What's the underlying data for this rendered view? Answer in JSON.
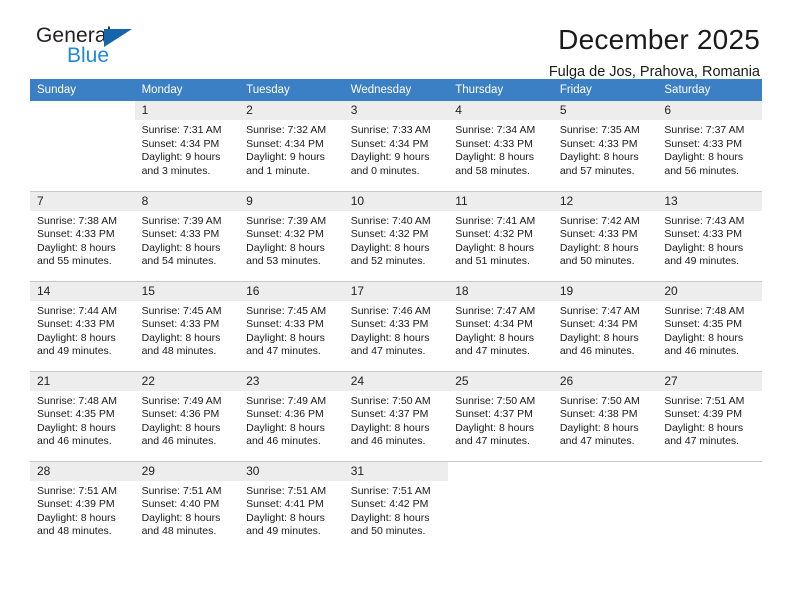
{
  "logo": {
    "word1": "General",
    "word2": "Blue",
    "triangle_color": "#1565ab",
    "word2_color": "#2389d4"
  },
  "header": {
    "title": "December 2025",
    "subtitle": "Fulga de Jos, Prahova, Romania"
  },
  "theme": {
    "header_row_bg": "#3b7fc4",
    "header_row_text": "#ffffff",
    "daynum_bg": "#ededed",
    "grid_line": "#c8c8c8"
  },
  "weekdays": [
    "Sunday",
    "Monday",
    "Tuesday",
    "Wednesday",
    "Thursday",
    "Friday",
    "Saturday"
  ],
  "weeks": [
    [
      {
        "day": "",
        "sunrise": "",
        "sunset": "",
        "daylight1": "",
        "daylight2": ""
      },
      {
        "day": "1",
        "sunrise": "Sunrise: 7:31 AM",
        "sunset": "Sunset: 4:34 PM",
        "daylight1": "Daylight: 9 hours",
        "daylight2": "and 3 minutes."
      },
      {
        "day": "2",
        "sunrise": "Sunrise: 7:32 AM",
        "sunset": "Sunset: 4:34 PM",
        "daylight1": "Daylight: 9 hours",
        "daylight2": "and 1 minute."
      },
      {
        "day": "3",
        "sunrise": "Sunrise: 7:33 AM",
        "sunset": "Sunset: 4:34 PM",
        "daylight1": "Daylight: 9 hours",
        "daylight2": "and 0 minutes."
      },
      {
        "day": "4",
        "sunrise": "Sunrise: 7:34 AM",
        "sunset": "Sunset: 4:33 PM",
        "daylight1": "Daylight: 8 hours",
        "daylight2": "and 58 minutes."
      },
      {
        "day": "5",
        "sunrise": "Sunrise: 7:35 AM",
        "sunset": "Sunset: 4:33 PM",
        "daylight1": "Daylight: 8 hours",
        "daylight2": "and 57 minutes."
      },
      {
        "day": "6",
        "sunrise": "Sunrise: 7:37 AM",
        "sunset": "Sunset: 4:33 PM",
        "daylight1": "Daylight: 8 hours",
        "daylight2": "and 56 minutes."
      }
    ],
    [
      {
        "day": "7",
        "sunrise": "Sunrise: 7:38 AM",
        "sunset": "Sunset: 4:33 PM",
        "daylight1": "Daylight: 8 hours",
        "daylight2": "and 55 minutes."
      },
      {
        "day": "8",
        "sunrise": "Sunrise: 7:39 AM",
        "sunset": "Sunset: 4:33 PM",
        "daylight1": "Daylight: 8 hours",
        "daylight2": "and 54 minutes."
      },
      {
        "day": "9",
        "sunrise": "Sunrise: 7:39 AM",
        "sunset": "Sunset: 4:32 PM",
        "daylight1": "Daylight: 8 hours",
        "daylight2": "and 53 minutes."
      },
      {
        "day": "10",
        "sunrise": "Sunrise: 7:40 AM",
        "sunset": "Sunset: 4:32 PM",
        "daylight1": "Daylight: 8 hours",
        "daylight2": "and 52 minutes."
      },
      {
        "day": "11",
        "sunrise": "Sunrise: 7:41 AM",
        "sunset": "Sunset: 4:32 PM",
        "daylight1": "Daylight: 8 hours",
        "daylight2": "and 51 minutes."
      },
      {
        "day": "12",
        "sunrise": "Sunrise: 7:42 AM",
        "sunset": "Sunset: 4:33 PM",
        "daylight1": "Daylight: 8 hours",
        "daylight2": "and 50 minutes."
      },
      {
        "day": "13",
        "sunrise": "Sunrise: 7:43 AM",
        "sunset": "Sunset: 4:33 PM",
        "daylight1": "Daylight: 8 hours",
        "daylight2": "and 49 minutes."
      }
    ],
    [
      {
        "day": "14",
        "sunrise": "Sunrise: 7:44 AM",
        "sunset": "Sunset: 4:33 PM",
        "daylight1": "Daylight: 8 hours",
        "daylight2": "and 49 minutes."
      },
      {
        "day": "15",
        "sunrise": "Sunrise: 7:45 AM",
        "sunset": "Sunset: 4:33 PM",
        "daylight1": "Daylight: 8 hours",
        "daylight2": "and 48 minutes."
      },
      {
        "day": "16",
        "sunrise": "Sunrise: 7:45 AM",
        "sunset": "Sunset: 4:33 PM",
        "daylight1": "Daylight: 8 hours",
        "daylight2": "and 47 minutes."
      },
      {
        "day": "17",
        "sunrise": "Sunrise: 7:46 AM",
        "sunset": "Sunset: 4:33 PM",
        "daylight1": "Daylight: 8 hours",
        "daylight2": "and 47 minutes."
      },
      {
        "day": "18",
        "sunrise": "Sunrise: 7:47 AM",
        "sunset": "Sunset: 4:34 PM",
        "daylight1": "Daylight: 8 hours",
        "daylight2": "and 47 minutes."
      },
      {
        "day": "19",
        "sunrise": "Sunrise: 7:47 AM",
        "sunset": "Sunset: 4:34 PM",
        "daylight1": "Daylight: 8 hours",
        "daylight2": "and 46 minutes."
      },
      {
        "day": "20",
        "sunrise": "Sunrise: 7:48 AM",
        "sunset": "Sunset: 4:35 PM",
        "daylight1": "Daylight: 8 hours",
        "daylight2": "and 46 minutes."
      }
    ],
    [
      {
        "day": "21",
        "sunrise": "Sunrise: 7:48 AM",
        "sunset": "Sunset: 4:35 PM",
        "daylight1": "Daylight: 8 hours",
        "daylight2": "and 46 minutes."
      },
      {
        "day": "22",
        "sunrise": "Sunrise: 7:49 AM",
        "sunset": "Sunset: 4:36 PM",
        "daylight1": "Daylight: 8 hours",
        "daylight2": "and 46 minutes."
      },
      {
        "day": "23",
        "sunrise": "Sunrise: 7:49 AM",
        "sunset": "Sunset: 4:36 PM",
        "daylight1": "Daylight: 8 hours",
        "daylight2": "and 46 minutes."
      },
      {
        "day": "24",
        "sunrise": "Sunrise: 7:50 AM",
        "sunset": "Sunset: 4:37 PM",
        "daylight1": "Daylight: 8 hours",
        "daylight2": "and 46 minutes."
      },
      {
        "day": "25",
        "sunrise": "Sunrise: 7:50 AM",
        "sunset": "Sunset: 4:37 PM",
        "daylight1": "Daylight: 8 hours",
        "daylight2": "and 47 minutes."
      },
      {
        "day": "26",
        "sunrise": "Sunrise: 7:50 AM",
        "sunset": "Sunset: 4:38 PM",
        "daylight1": "Daylight: 8 hours",
        "daylight2": "and 47 minutes."
      },
      {
        "day": "27",
        "sunrise": "Sunrise: 7:51 AM",
        "sunset": "Sunset: 4:39 PM",
        "daylight1": "Daylight: 8 hours",
        "daylight2": "and 47 minutes."
      }
    ],
    [
      {
        "day": "28",
        "sunrise": "Sunrise: 7:51 AM",
        "sunset": "Sunset: 4:39 PM",
        "daylight1": "Daylight: 8 hours",
        "daylight2": "and 48 minutes."
      },
      {
        "day": "29",
        "sunrise": "Sunrise: 7:51 AM",
        "sunset": "Sunset: 4:40 PM",
        "daylight1": "Daylight: 8 hours",
        "daylight2": "and 48 minutes."
      },
      {
        "day": "30",
        "sunrise": "Sunrise: 7:51 AM",
        "sunset": "Sunset: 4:41 PM",
        "daylight1": "Daylight: 8 hours",
        "daylight2": "and 49 minutes."
      },
      {
        "day": "31",
        "sunrise": "Sunrise: 7:51 AM",
        "sunset": "Sunset: 4:42 PM",
        "daylight1": "Daylight: 8 hours",
        "daylight2": "and 50 minutes."
      },
      {
        "day": "",
        "sunrise": "",
        "sunset": "",
        "daylight1": "",
        "daylight2": ""
      },
      {
        "day": "",
        "sunrise": "",
        "sunset": "",
        "daylight1": "",
        "daylight2": ""
      },
      {
        "day": "",
        "sunrise": "",
        "sunset": "",
        "daylight1": "",
        "daylight2": ""
      }
    ]
  ]
}
